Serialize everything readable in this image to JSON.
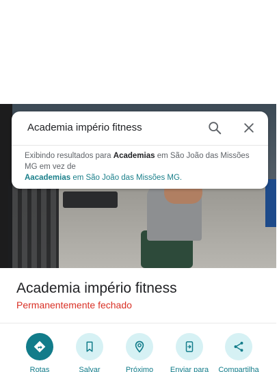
{
  "search": {
    "query": "Academia império fitness"
  },
  "correction": {
    "prefix": "Exibindo resultados para ",
    "term": "Academias",
    "middle": " em São João das Missões MG em vez de",
    "original_term": "Aacademias",
    "suffix": " em São João das Missões MG."
  },
  "place": {
    "title": "Academia império fitness",
    "status": "Permanentemente fechado"
  },
  "actions": [
    {
      "label": "Rotas",
      "icon": "directions-icon"
    },
    {
      "label": "Salvar",
      "icon": "bookmark-icon"
    },
    {
      "label": "Próximo",
      "icon": "nearby-icon"
    },
    {
      "label": "Enviar para",
      "icon": "send-to-phone-icon"
    },
    {
      "label": "Compartilha",
      "icon": "share-icon"
    }
  ],
  "colors": {
    "accent": "#127c8a",
    "accent_light": "#d6f1f4",
    "status_closed": "#d93025"
  }
}
